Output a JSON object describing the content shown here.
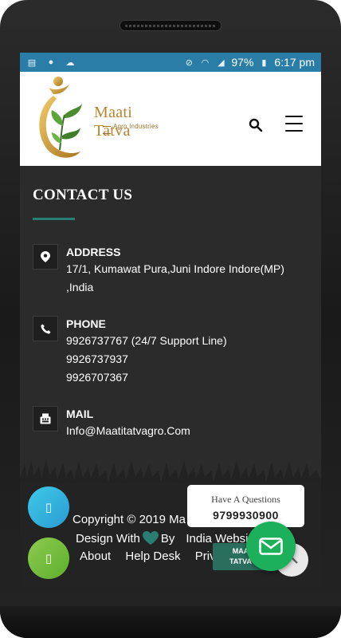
{
  "status_bar": {
    "battery": "97%",
    "time": "6:17 pm"
  },
  "header": {
    "brand_name": "Maati Tatva",
    "brand_tagline": "Agro Industries"
  },
  "contact": {
    "title": "CONTACT US",
    "address": {
      "label": "ADDRESS",
      "line1": "17/1, Kumawat Pura,Juni Indore Indore(MP)",
      "line2": ",India"
    },
    "phone": {
      "label": "PHONE",
      "line1": "9926737767 (24/7 Support Line)",
      "line2": "9926737937",
      "line3": "9926707367"
    },
    "mail": {
      "label": "MAIL",
      "value": "Info@Maatitatvagro.Com"
    }
  },
  "footer": {
    "copyright": "Copyright © 2019 Ma",
    "design_with": "Design With",
    "by": "By",
    "company": "India Websi",
    "links": [
      "About",
      "Help Desk",
      "Priv"
    ]
  },
  "widgets": {
    "question_title": "Have A Questions",
    "question_phone": "9799930900",
    "chip_line1": "MAA",
    "chip_line2": "TATVA"
  },
  "colors": {
    "status_bar": "#2a7da6",
    "accent_teal": "#2a7d73",
    "mail_green": "#1db05a",
    "brand_gold": "#b8862e"
  }
}
